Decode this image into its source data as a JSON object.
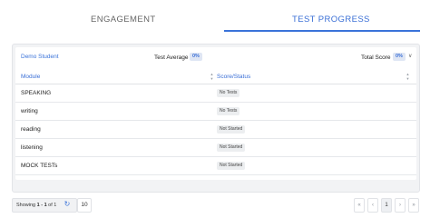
{
  "tabs": [
    {
      "label": "ENGAGEMENT",
      "active": false
    },
    {
      "label": "TEST PROGRESS",
      "active": true
    }
  ],
  "summary": {
    "student_name": "Demo Student",
    "test_average_label": "Test Average",
    "test_average_value": "0%",
    "total_score_label": "Total Score",
    "total_score_value": "0%"
  },
  "table": {
    "columns": [
      "Module",
      "Score/Status"
    ],
    "rows": [
      {
        "module": "SPEAKING",
        "status": "No Tests"
      },
      {
        "module": "writing",
        "status": "No Tests"
      },
      {
        "module": "reading",
        "status": "Not Started"
      },
      {
        "module": "listening",
        "status": "Not Started"
      },
      {
        "module": "MOCK TESTs",
        "status": "Not Started"
      }
    ]
  },
  "footer": {
    "showing_prefix": "Showing ",
    "showing_range": "1 - 1",
    "showing_suffix": " of 1",
    "page_size": "10",
    "current_page": "1",
    "pager_icons": [
      "first-page-icon",
      "prev-page-icon",
      "next-page-icon",
      "last-page-icon"
    ]
  },
  "colors": {
    "accent": "#3a73d9",
    "panel_bg": "#f2f3f5",
    "badge_bg": "#dfe6f4",
    "chip_bg": "#eceef0"
  }
}
